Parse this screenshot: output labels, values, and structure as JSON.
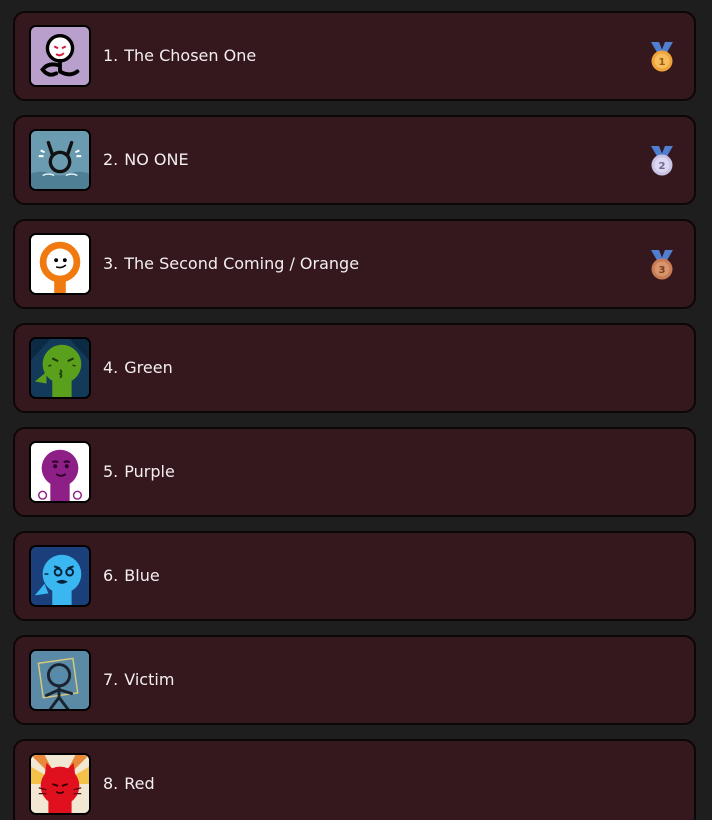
{
  "leaderboard": {
    "entries": [
      {
        "rank": "1.",
        "name": "The Chosen One",
        "medal": "gold-medal",
        "medal_number": "1"
      },
      {
        "rank": "2.",
        "name": "NO ONE",
        "medal": "silver-medal",
        "medal_number": "2"
      },
      {
        "rank": "3.",
        "name": "The Second Coming / Orange",
        "medal": "bronze-medal",
        "medal_number": "3"
      },
      {
        "rank": "4.",
        "name": "Green"
      },
      {
        "rank": "5.",
        "name": "Purple"
      },
      {
        "rank": "6.",
        "name": "Blue"
      },
      {
        "rank": "7.",
        "name": "Victim"
      },
      {
        "rank": "8.",
        "name": "Red"
      }
    ]
  },
  "colors": {
    "background": "#1e1e1f",
    "row": "#35181d",
    "text": "#f3eef0",
    "gold": "#f0a23b",
    "silver": "#c9c3e6",
    "bronze": "#c87c55",
    "ribbon": "#4f7fd1"
  }
}
